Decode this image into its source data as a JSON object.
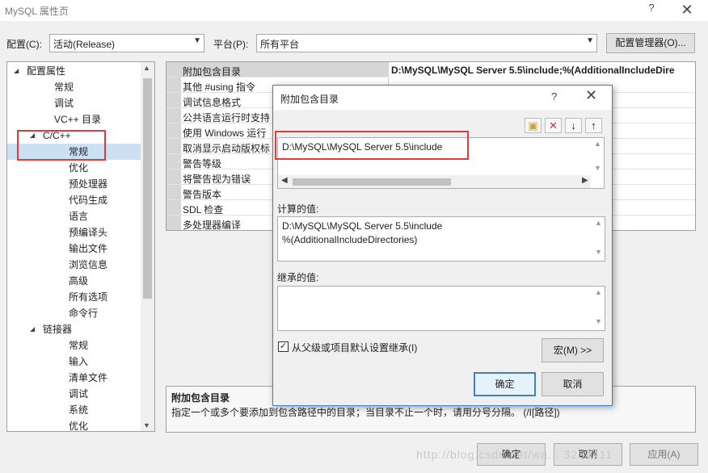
{
  "window": {
    "title": "MySQL 属性页",
    "help": "?",
    "close": "✕"
  },
  "toolbar": {
    "config_label": "配置(C):",
    "config_value": "活动(Release)",
    "platform_label": "平台(P):",
    "platform_value": "所有平台",
    "config_manager_label": "配置管理器(O)..."
  },
  "tree": {
    "items": [
      {
        "label": "配置属性",
        "expand": "◢"
      },
      {
        "label": "常规"
      },
      {
        "label": "调试"
      },
      {
        "label": "VC++ 目录"
      },
      {
        "label": "C/C++",
        "expand": "◢"
      },
      {
        "label": "常规"
      },
      {
        "label": "优化"
      },
      {
        "label": "预处理器"
      },
      {
        "label": "代码生成"
      },
      {
        "label": "语言"
      },
      {
        "label": "预编译头"
      },
      {
        "label": "输出文件"
      },
      {
        "label": "浏览信息"
      },
      {
        "label": "高级"
      },
      {
        "label": "所有选项"
      },
      {
        "label": "命令行"
      },
      {
        "label": "链接器",
        "expand": "◢"
      },
      {
        "label": "常规"
      },
      {
        "label": "输入"
      },
      {
        "label": "清单文件"
      },
      {
        "label": "调试"
      },
      {
        "label": "系统"
      },
      {
        "label": "优化"
      }
    ]
  },
  "grid": {
    "rows": [
      {
        "name": "附加包含目录",
        "value": "D:\\MySQL\\MySQL Server 5.5\\include;%(AdditionalIncludeDire"
      },
      {
        "name": "其他 #using 指令",
        "value": ""
      },
      {
        "name": "调试信息格式",
        "value": ""
      },
      {
        "name": "公共语言运行时支持",
        "value": ""
      },
      {
        "name": "使用 Windows 运行",
        "value": ""
      },
      {
        "name": "取消显示启动版权标",
        "value": ""
      },
      {
        "name": "警告等级",
        "value": ""
      },
      {
        "name": "将警告视为错误",
        "value": ""
      },
      {
        "name": "警告版本",
        "value": ""
      },
      {
        "name": "SDL 检查",
        "value": ""
      },
      {
        "name": "多处理器编译",
        "value": ""
      }
    ]
  },
  "description": {
    "heading": "附加包含目录",
    "text": "指定一个或多个要添加到包含路径中的目录；当目录不止一个时，请用分号分隔。     (/I[路径])"
  },
  "modal": {
    "title": "附加包含目录",
    "help": "?",
    "close": "✕",
    "toolbar_icons": [
      "new-folder-icon",
      "delete-icon",
      "move-down-icon",
      "move-up-icon"
    ],
    "entry": "D:\\MySQL\\MySQL Server 5.5\\include",
    "computed_label": "计算的值:",
    "computed_lines": [
      "D:\\MySQL\\MySQL Server 5.5\\include",
      "%(AdditionalIncludeDirectories)"
    ],
    "inherited_label": "继承的值:",
    "inherit_checkbox_label": "从父级或项目默认设置继承(I)",
    "inherit_checked": true,
    "macro_button": "宏(M) >>",
    "ok_button": "确定",
    "cancel_button": "取消"
  },
  "footer": {
    "ok": "确定",
    "cancel": "取消",
    "apply": "应用(A)"
  },
  "watermark": "http://blog.csdn.net/wa... 3234411",
  "colors": {
    "highlight_box": "#e53935",
    "selection": "#cce0f3",
    "accent": "#3f7fc5"
  }
}
